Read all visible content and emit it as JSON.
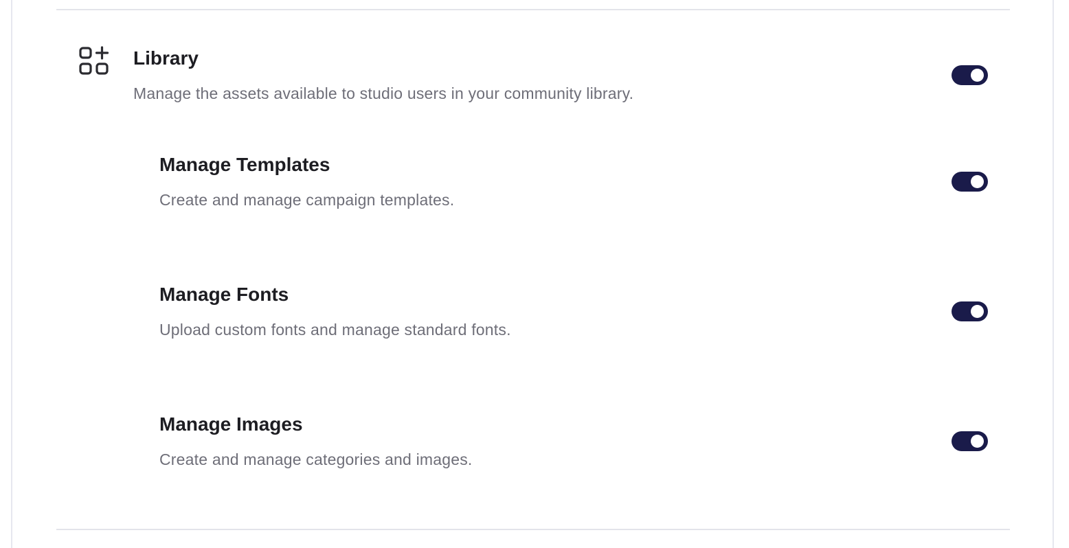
{
  "section": {
    "icon": "library-grid-plus-icon",
    "title": "Library",
    "description": "Manage the assets available to studio users in your community library.",
    "enabled": true
  },
  "items": [
    {
      "title": "Manage Templates",
      "description": "Create and manage campaign templates.",
      "enabled": true
    },
    {
      "title": "Manage Fonts",
      "description": "Upload custom fonts and manage standard fonts.",
      "enabled": true
    },
    {
      "title": "Manage Images",
      "description": "Create and manage categories and images.",
      "enabled": true
    }
  ],
  "colors": {
    "toggle_on": "#1a1b4a",
    "title": "#1d1d22",
    "description": "#6e6e78",
    "divider": "#e3e4ea"
  }
}
